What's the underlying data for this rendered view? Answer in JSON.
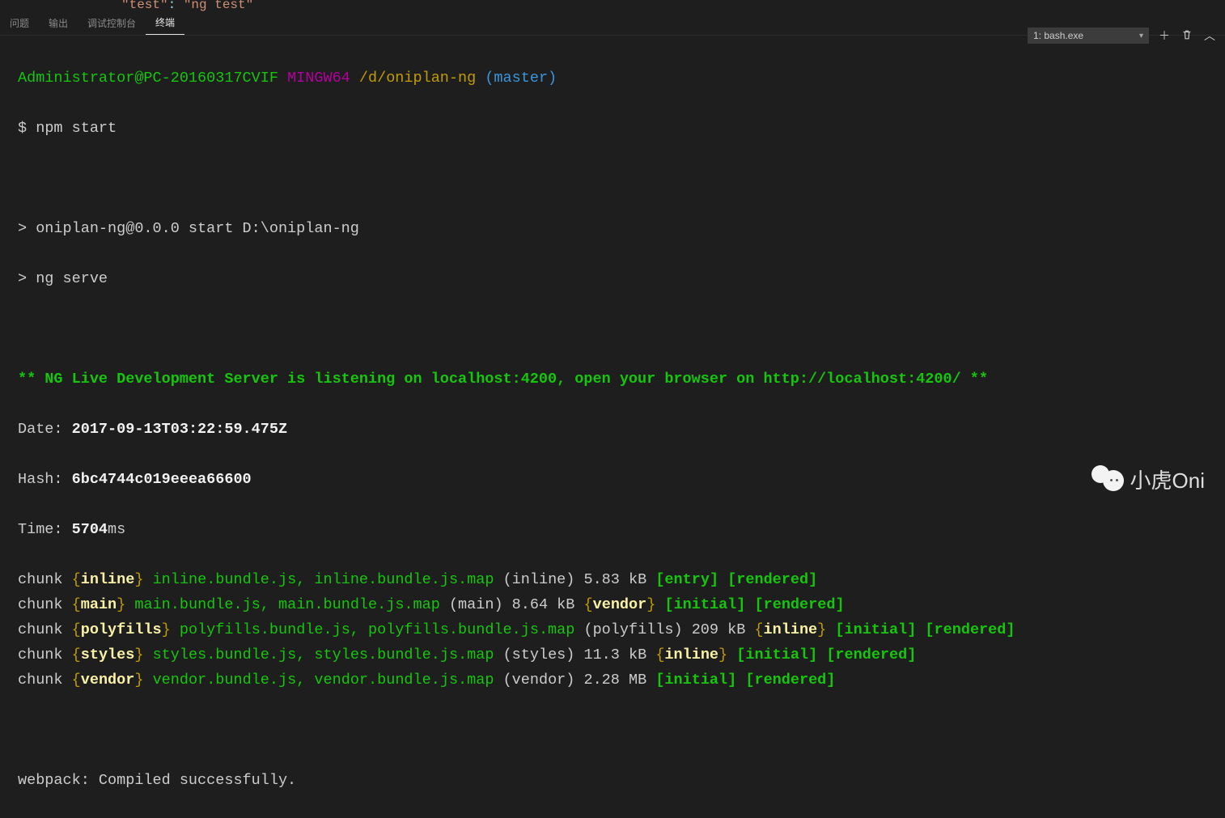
{
  "editor_snippet": {
    "key": "\"test\"",
    "colon": ": ",
    "val": "\"ng test\""
  },
  "tabs": {
    "problems": "问题",
    "output": "输出",
    "debug": "调试控制台",
    "terminal": "终端"
  },
  "toolbar": {
    "dropdown_label": "1: bash.exe",
    "new_terminal_icon_name": "plus-icon",
    "kill_terminal_icon_name": "trash-icon",
    "maximize_icon_name": "chevron-up-icon"
  },
  "prompt": {
    "user_host": "Administrator@PC-20160317CVIF",
    "msystem": "MINGW64",
    "cwd": "/d/oniplan-ng",
    "branch": "(master)",
    "symbol": "$",
    "command": "npm start"
  },
  "npm": {
    "line1": "> oniplan-ng@0.0.0 start D:\\oniplan-ng",
    "line2": "> ng serve"
  },
  "ng_banner": "** NG Live Development Server is listening on localhost:4200, open your browser on http://localhost:4200/ **",
  "build": {
    "date_label": "Date: ",
    "date_value": "2017-09-13T03:22:59.475Z",
    "hash_label": "Hash: ",
    "hash_value": "6bc4744c019eeea66600",
    "time_label": "Time: ",
    "time_value": "5704",
    "time_suffix": "ms"
  },
  "chunks": [
    {
      "name": "inline",
      "files": "inline.bundle.js, inline.bundle.js.map",
      "paren": "(inline)",
      "size": "5.83 kB",
      "tag1_type": "bracket",
      "tag1_text": "entry",
      "tag2_type": "bracket",
      "tag2_text": "rendered",
      "tag3_type": null,
      "tag3_text": null
    },
    {
      "name": "main",
      "files": "main.bundle.js, main.bundle.js.map",
      "paren": "(main)",
      "size": "8.64 kB",
      "tag1_type": "brace",
      "tag1_text": "vendor",
      "tag2_type": "bracket",
      "tag2_text": "initial",
      "tag3_type": "bracket",
      "tag3_text": "rendered"
    },
    {
      "name": "polyfills",
      "files": "polyfills.bundle.js, polyfills.bundle.js.map",
      "paren": "(polyfills)",
      "size": "209 kB",
      "tag1_type": "brace",
      "tag1_text": "inline",
      "tag2_type": "bracket",
      "tag2_text": "initial",
      "tag3_type": "bracket",
      "tag3_text": "rendered"
    },
    {
      "name": "styles",
      "files": "styles.bundle.js, styles.bundle.js.map",
      "paren": "(styles)",
      "size": "11.3 kB",
      "tag1_type": "brace",
      "tag1_text": "inline",
      "tag2_type": "bracket",
      "tag2_text": "initial",
      "tag3_type": "bracket",
      "tag3_text": "rendered"
    },
    {
      "name": "vendor",
      "files": "vendor.bundle.js, vendor.bundle.js.map",
      "paren": "(vendor)",
      "size": "2.28 MB",
      "tag1_type": "bracket",
      "tag1_text": "initial",
      "tag2_type": "bracket",
      "tag2_text": "rendered",
      "tag3_type": null,
      "tag3_text": null
    }
  ],
  "webpack_status": "webpack: Compiled successfully.",
  "watermark_text": "小虎Oni"
}
